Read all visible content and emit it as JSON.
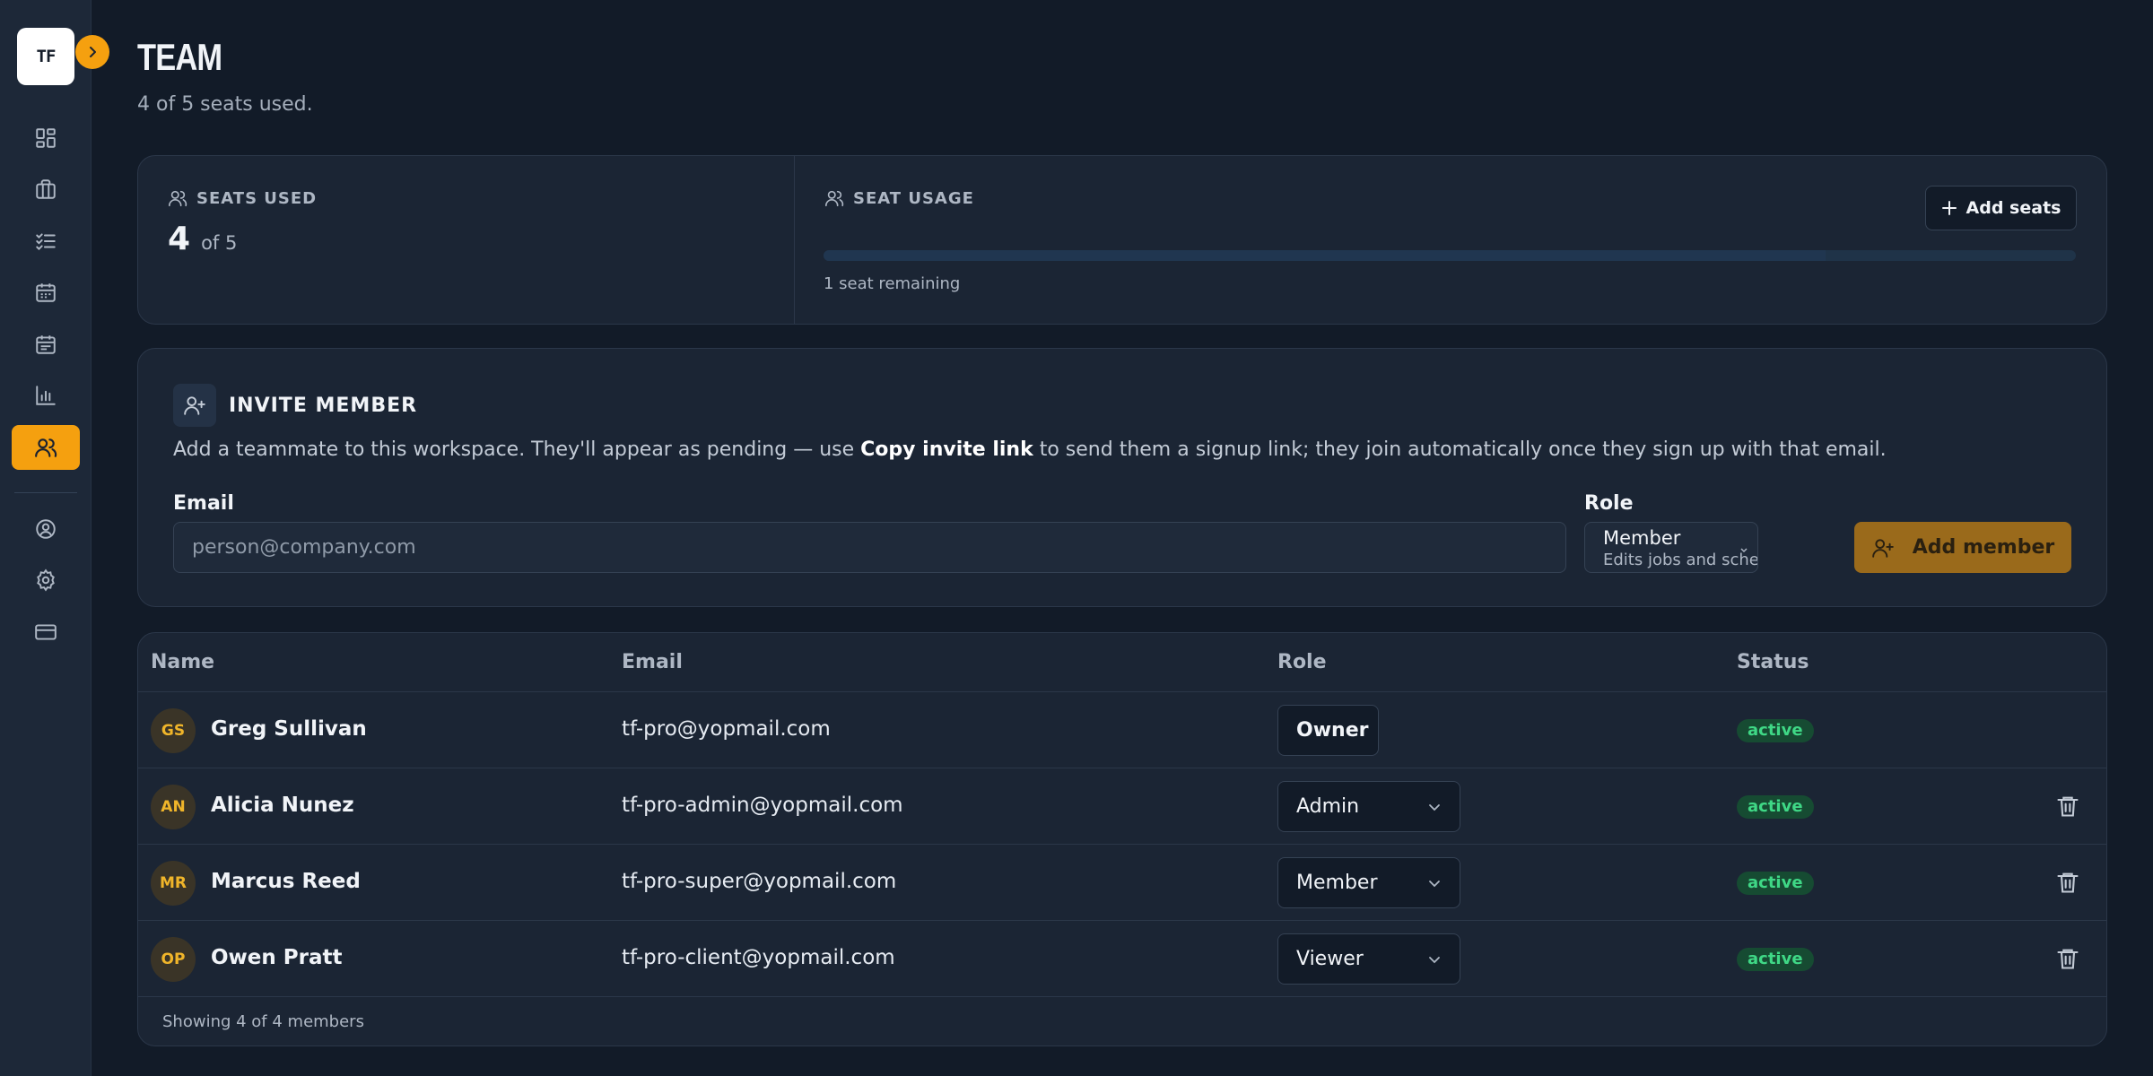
{
  "brand": {
    "logo_text": "TF",
    "accent": "#f5a00f"
  },
  "sidebar": {
    "items": [
      {
        "icon": "dashboard-icon",
        "active": false
      },
      {
        "icon": "briefcase-icon",
        "active": false
      },
      {
        "icon": "checklist-icon",
        "active": false
      },
      {
        "icon": "calendar-icon",
        "active": false
      },
      {
        "icon": "calendar-schedule-icon",
        "active": false
      },
      {
        "icon": "bar-chart-icon",
        "active": false
      },
      {
        "icon": "team-icon",
        "active": true
      },
      {
        "icon": "user-circle-icon",
        "active": false
      },
      {
        "icon": "gear-icon",
        "active": false
      },
      {
        "icon": "credit-card-icon",
        "active": false
      }
    ]
  },
  "header": {
    "title": "TEAM",
    "subtitle": "4 of 5 seats used."
  },
  "seats": {
    "label": "SEATS USED",
    "used": "4",
    "of_total": "of 5",
    "usage_label": "SEAT USAGE",
    "add_seats_label": "Add seats",
    "remaining_text": "1 seat remaining",
    "usage_fraction": 0.8
  },
  "invite": {
    "title": "INVITE MEMBER",
    "desc_before": "Add a teammate to this workspace. They'll appear as pending — use ",
    "desc_link": "Copy invite link",
    "desc_after": " to send them a signup link; they join automatically once they sign up with that email.",
    "email_label": "Email",
    "email_placeholder": "person@company.com",
    "role_label": "Role",
    "role_value": "Member",
    "role_desc": "Edits jobs and schedules",
    "submit_label": "Add member"
  },
  "table": {
    "columns": [
      "Name",
      "Email",
      "Role",
      "Status"
    ],
    "rows": [
      {
        "initials": "GS",
        "name": "Greg Sullivan",
        "email": "tf-pro@yopmail.com",
        "role": "Owner",
        "status": "active"
      },
      {
        "initials": "AN",
        "name": "Alicia Nunez",
        "email": "tf-pro-admin@yopmail.com",
        "role": "Admin",
        "status": "active"
      },
      {
        "initials": "MR",
        "name": "Marcus Reed",
        "email": "tf-pro-super@yopmail.com",
        "role": "Member",
        "status": "active"
      },
      {
        "initials": "OP",
        "name": "Owen Pratt",
        "email": "tf-pro-client@yopmail.com",
        "role": "Viewer",
        "status": "active"
      }
    ],
    "footer": "Showing 4 of 4 members"
  },
  "colors": {
    "active_badge_bg": "#164b32",
    "active_badge_text": "#3fd886"
  }
}
